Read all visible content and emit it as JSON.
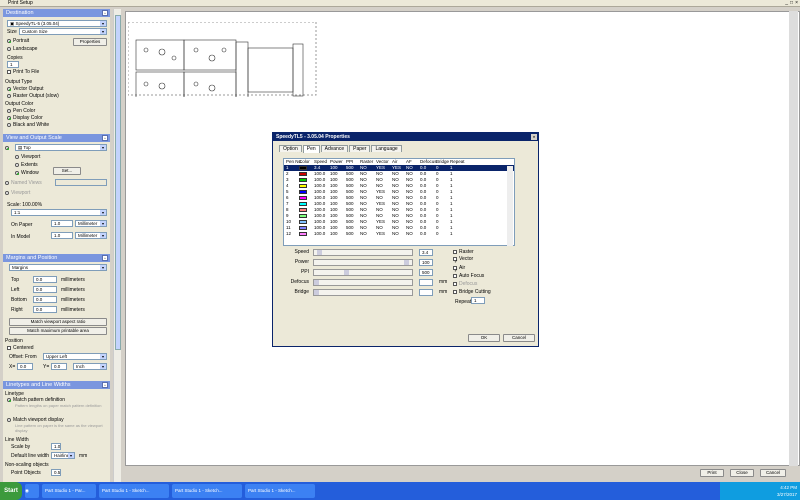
{
  "window": {
    "title": "Print Setup",
    "controls": [
      "_",
      "□",
      "×"
    ]
  },
  "destination": {
    "header": "Destination",
    "printer": "SpeedyTL-5 (3.05.04)",
    "size_label": "Size",
    "size_value": "Custom Size",
    "orientation": [
      "Portrait",
      "Landscape"
    ],
    "properties_btn": "Properties",
    "copies_label": "Copies",
    "copies_value": "1",
    "print_to_file": "Print To File",
    "output_type_label": "Output Type",
    "output_types": [
      "Vector Output",
      "Raster Output (slow)"
    ],
    "output_color_label": "Output Color",
    "output_colors": [
      "Pen Color",
      "Display Color",
      "Black and White"
    ]
  },
  "view": {
    "header": "View and Output Scale",
    "view_value": "Top",
    "view_options": [
      "Viewport",
      "Extents",
      "Window"
    ],
    "set_btn": "Set...",
    "named_views": "Named Views",
    "viewport": "Viewport",
    "scale_label": "Scale: 100.00%",
    "scale_value": "1:1",
    "on_paper_label": "On Paper",
    "on_paper_value": "1.0",
    "on_paper_unit": "Millimeter",
    "in_model_label": "In Model",
    "in_model_value": "1.0",
    "in_model_unit": "Millimeter"
  },
  "margins": {
    "header": "Margins and Position",
    "mode": "Margins",
    "fields": [
      {
        "label": "Top",
        "value": "0.0",
        "unit": "millimeters"
      },
      {
        "label": "Left",
        "value": "0.0",
        "unit": "millimeters"
      },
      {
        "label": "Bottom",
        "value": "0.0",
        "unit": "millimeters"
      },
      {
        "label": "Right",
        "value": "0.0",
        "unit": "millimeters"
      }
    ],
    "match_aspect_btn": "Match viewport aspect ratio",
    "match_max_btn": "Match maximum printable area",
    "position_label": "Position",
    "centered": "Centered",
    "offset_label": "Offset: From",
    "offset_value": "Upper Left",
    "x_label": "X=",
    "x_value": "0.0",
    "y_label": "Y=",
    "y_value": "0.0",
    "offset_unit": "Inch"
  },
  "linetypes": {
    "header": "Linetypes and Line Widths",
    "linetype_label": "Linetype",
    "match_pattern": "Match pattern definition",
    "pattern_note": "Pattern lengths on paper match pattern definition",
    "match_display": "Match viewport display",
    "display_note": "Line pattern on paper is the same as the viewport display",
    "line_width_label": "Line Width",
    "scale_by_label": "Scale by",
    "scale_by_value": "1.0",
    "default_width_label": "Default line width",
    "default_width_value": "Hairline",
    "default_width_unit": "mm",
    "nonscaling_label": "Non-scaling objects",
    "point_objects_label": "Point Objects",
    "point_objects_value": "0.5"
  },
  "bottom_buttons": {
    "print": "Print",
    "close": "Close",
    "cancel": "Cancel"
  },
  "dialog": {
    "title": "SpeedyTL5 - 3.05.04 Properties",
    "tabs": [
      "Option",
      "Pen",
      "Advance",
      "Paper",
      "Language"
    ],
    "active_tab": "Pen",
    "columns": [
      "Pen No.",
      "Color",
      "Speed",
      "Power",
      "PPI",
      "Raster",
      "Vector",
      "Air",
      "AF",
      "Defocus",
      "Bridge",
      "Repeat"
    ],
    "rows": [
      {
        "no": "1",
        "color": "#000000",
        "speed": "3.4",
        "power": "100",
        "ppi": "500",
        "raster": "NO",
        "vector": "YES",
        "air": "YES",
        "af": "NO",
        "defocus": "0.0",
        "bridge": "0",
        "repeat": "1"
      },
      {
        "no": "2",
        "color": "#cc0000",
        "speed": "100.0",
        "power": "100",
        "ppi": "500",
        "raster": "NO",
        "vector": "NO",
        "air": "NO",
        "af": "NO",
        "defocus": "0.0",
        "bridge": "0",
        "repeat": "1"
      },
      {
        "no": "3",
        "color": "#00cc00",
        "speed": "100.0",
        "power": "100",
        "ppi": "500",
        "raster": "NO",
        "vector": "NO",
        "air": "NO",
        "af": "NO",
        "defocus": "0.0",
        "bridge": "0",
        "repeat": "1"
      },
      {
        "no": "4",
        "color": "#ffff00",
        "speed": "100.0",
        "power": "100",
        "ppi": "500",
        "raster": "NO",
        "vector": "NO",
        "air": "NO",
        "af": "NO",
        "defocus": "0.0",
        "bridge": "0",
        "repeat": "1"
      },
      {
        "no": "5",
        "color": "#0000ff",
        "speed": "100.0",
        "power": "100",
        "ppi": "500",
        "raster": "NO",
        "vector": "YES",
        "air": "NO",
        "af": "NO",
        "defocus": "0.0",
        "bridge": "0",
        "repeat": "1"
      },
      {
        "no": "6",
        "color": "#ff00ff",
        "speed": "100.0",
        "power": "100",
        "ppi": "500",
        "raster": "NO",
        "vector": "NO",
        "air": "NO",
        "af": "NO",
        "defocus": "0.0",
        "bridge": "0",
        "repeat": "1"
      },
      {
        "no": "7",
        "color": "#00ffff",
        "speed": "100.0",
        "power": "100",
        "ppi": "500",
        "raster": "NO",
        "vector": "YES",
        "air": "NO",
        "af": "NO",
        "defocus": "0.0",
        "bridge": "0",
        "repeat": "1"
      },
      {
        "no": "8",
        "color": "#ff8080",
        "speed": "100.0",
        "power": "100",
        "ppi": "500",
        "raster": "NO",
        "vector": "NO",
        "air": "NO",
        "af": "NO",
        "defocus": "0.0",
        "bridge": "0",
        "repeat": "1"
      },
      {
        "no": "9",
        "color": "#80ff80",
        "speed": "100.0",
        "power": "100",
        "ppi": "500",
        "raster": "NO",
        "vector": "NO",
        "air": "NO",
        "af": "NO",
        "defocus": "0.0",
        "bridge": "0",
        "repeat": "1"
      },
      {
        "no": "10",
        "color": "#80c0ff",
        "speed": "100.0",
        "power": "100",
        "ppi": "500",
        "raster": "NO",
        "vector": "YES",
        "air": "NO",
        "af": "NO",
        "defocus": "0.0",
        "bridge": "0",
        "repeat": "1"
      },
      {
        "no": "11",
        "color": "#8080ff",
        "speed": "100.0",
        "power": "100",
        "ppi": "500",
        "raster": "NO",
        "vector": "NO",
        "air": "NO",
        "af": "NO",
        "defocus": "0.0",
        "bridge": "0",
        "repeat": "1"
      },
      {
        "no": "12",
        "color": "#ff80ff",
        "speed": "100.0",
        "power": "100",
        "ppi": "500",
        "raster": "NO",
        "vector": "YES",
        "air": "NO",
        "af": "NO",
        "defocus": "0.0",
        "bridge": "0",
        "repeat": "1"
      }
    ],
    "speed_label": "Speed",
    "speed_value": "3.4",
    "speed_fraction": 0.034,
    "power_label": "Power",
    "power_value": "100",
    "power_fraction": 1.0,
    "ppi_label": "PPI",
    "ppi_value": "500",
    "ppi_fraction": 0.33,
    "defocus_label": "Defocus",
    "defocus_unit": "mm",
    "bridge_label": "Bridge",
    "bridge_unit": "mm",
    "checks": [
      "Raster",
      "Vector",
      "Air",
      "Auto Focus",
      "Defocus",
      "Bridge Cutting"
    ],
    "repeat_label": "Repeat",
    "repeat_value": "1",
    "ok": "OK",
    "cancel": "Cancel"
  },
  "taskbar": {
    "start": "Start",
    "items": [
      "Part Studio 1 - Par...",
      "Part Studio 1 - Sketch...",
      "Part Studio 1 - Sketch...",
      "Part Studio 1 - Sketch..."
    ],
    "time": "4:42 PM",
    "date": "3/27/2017"
  }
}
